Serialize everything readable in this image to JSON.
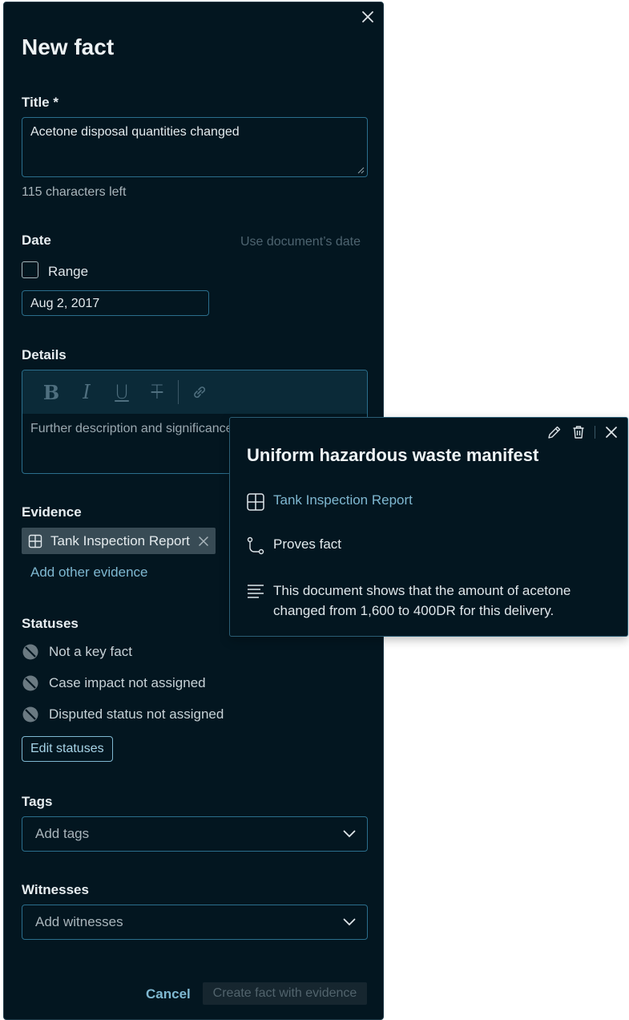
{
  "panel": {
    "title": "New fact",
    "title_field": {
      "label": "Title *",
      "value": "Acetone disposal quantities changed",
      "hint": "115 characters left"
    },
    "date": {
      "label": "Date",
      "use_doc_date": "Use document’s date",
      "range_label": "Range",
      "value": "Aug 2, 2017"
    },
    "details": {
      "label": "Details",
      "placeholder": "Further description and significance"
    },
    "evidence": {
      "label": "Evidence",
      "chip": "Tank Inspection Report",
      "add_other": "Add other evidence"
    },
    "statuses": {
      "label": "Statuses",
      "items": [
        "Not a key fact",
        "Case impact not assigned",
        "Disputed status not assigned"
      ],
      "edit_button": "Edit statuses"
    },
    "tags": {
      "label": "Tags",
      "placeholder": "Add tags"
    },
    "witnesses": {
      "label": "Witnesses",
      "placeholder": "Add witnesses"
    },
    "footer": {
      "cancel": "Cancel",
      "create": "Create fact with evidence"
    }
  },
  "popover": {
    "title": "Uniform hazardous waste manifest",
    "document_link": "Tank Inspection Report",
    "relation": "Proves fact",
    "description": "This document shows that the amount of acetone changed from 1,600 to 400DR for this delivery."
  },
  "colors": {
    "panel_bg": "#031620",
    "accent": "#7fb8d1",
    "border": "#2b6e8c"
  }
}
